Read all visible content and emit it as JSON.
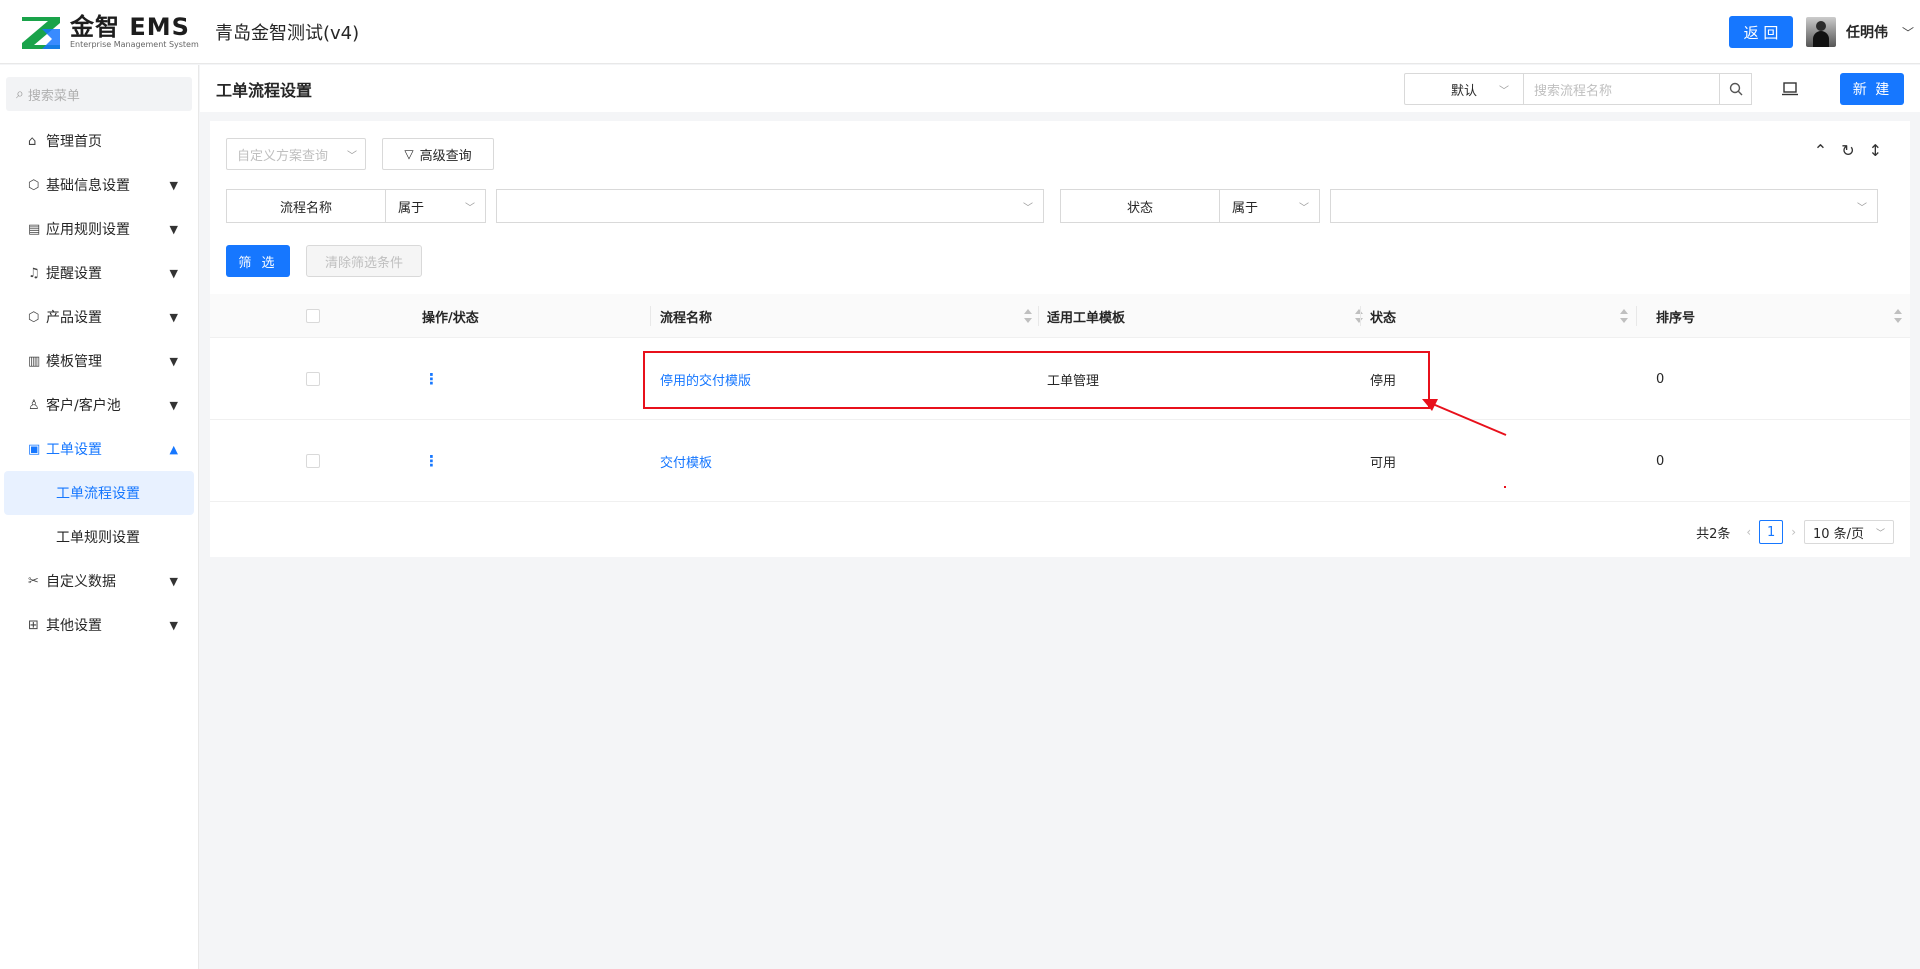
{
  "header": {
    "logo_main": "金智 EMS",
    "logo_sub": "Enterprise Management System",
    "app_title": "青岛金智测试(v4)",
    "back_label": "返 回",
    "user_name": "任明伟"
  },
  "sidebar": {
    "search_placeholder": "搜索菜单",
    "items": [
      {
        "label": "管理首页",
        "icon": "home-icon"
      },
      {
        "label": "基础信息设置",
        "icon": "cube-icon"
      },
      {
        "label": "应用规则设置",
        "icon": "document-icon"
      },
      {
        "label": "提醒设置",
        "icon": "bell-icon"
      },
      {
        "label": "产品设置",
        "icon": "box-icon"
      },
      {
        "label": "模板管理",
        "icon": "template-icon"
      },
      {
        "label": "客户/客户池",
        "icon": "contacts-icon"
      },
      {
        "label": "工单设置",
        "icon": "form-icon"
      },
      {
        "label": "自定义数据",
        "icon": "tools-icon"
      },
      {
        "label": "其他设置",
        "icon": "apps-icon"
      }
    ],
    "sub_items": [
      "工单流程设置",
      "工单规则设置"
    ]
  },
  "page": {
    "title": "工单流程设置",
    "view_select": "默认",
    "search_placeholder": "搜索流程名称",
    "new_label": "新 建"
  },
  "filters": {
    "scheme_placeholder": "自定义方案查询",
    "advanced_label": "高级查询",
    "cond1_label": "流程名称",
    "cond1_op": "属于",
    "cond2_label": "状态",
    "cond2_op": "属于",
    "filter_label": "筛 选",
    "clear_label": "清除筛选条件"
  },
  "table": {
    "columns": [
      "操作/状态",
      "流程名称",
      "适用工单模板",
      "状态",
      "排序号"
    ],
    "rows": [
      {
        "action": "⋮",
        "name": "停用的交付模版",
        "template": "工单管理",
        "status": "停用",
        "order": "0"
      },
      {
        "action": "⋮",
        "name": "交付模板",
        "template": "",
        "status": "可用",
        "order": "0"
      }
    ]
  },
  "pagination": {
    "total": "共2条",
    "current_page": "1",
    "page_size": "10 条/页"
  },
  "colors": {
    "primary": "#1677ff",
    "annotation": "#e8101b"
  }
}
